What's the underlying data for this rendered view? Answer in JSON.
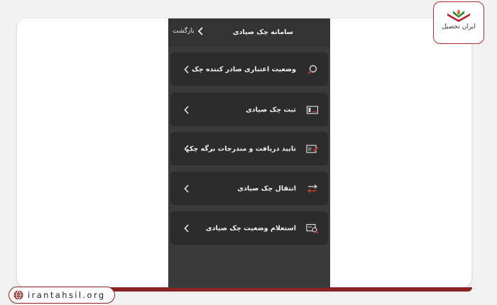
{
  "header": {
    "title": "سامانه چک صیادی",
    "back_label": "بازگشت"
  },
  "menu": [
    {
      "label": "وضعیت اعتباری صادر کننده چک",
      "icon": "search-icon"
    },
    {
      "label": "ثبت چک صیادی",
      "icon": "cheque-card-icon"
    },
    {
      "label": "تایید دریافت و مندرجات برگه چک",
      "icon": "cheque-check-icon"
    },
    {
      "label": "انتقال چک صیادی",
      "icon": "transfer-arrows-icon"
    },
    {
      "label": "استعلام وضعیت چک صیادی",
      "icon": "cheque-search-icon"
    }
  ],
  "branding": {
    "logo_text": "ایران تحصیل",
    "site_url": "irantahsil.org"
  },
  "colors": {
    "phone_bg": "#3a3a3a",
    "item_bg": "#2c2c2c",
    "accent_red": "#c0392b",
    "brand_red": "#8c2323"
  }
}
